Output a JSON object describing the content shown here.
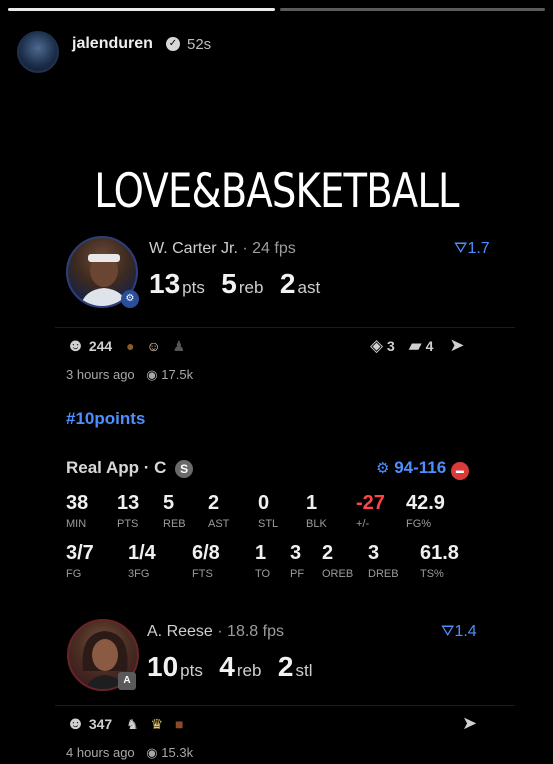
{
  "header": {
    "username": "jalenduren",
    "time": "52s"
  },
  "title": "LOVE&BASKETBALL",
  "post1": {
    "name": "W. Carter Jr.",
    "fps": "· 24 fps",
    "trend": "1.7",
    "stats": [
      {
        "value": "13",
        "unit": "pts"
      },
      {
        "value": "5",
        "unit": "reb"
      },
      {
        "value": "2",
        "unit": "ast"
      }
    ],
    "reactions_count": "244",
    "comments_count": "3",
    "cards_count": "4",
    "time_ago": "3 hours ago",
    "views": "17.5k"
  },
  "hashtag": "#10points",
  "boxscore": {
    "title": "Real App · C",
    "badge": "S",
    "score": "94-116",
    "row1": [
      {
        "value": "38",
        "label": "MIN"
      },
      {
        "value": "13",
        "label": "PTS"
      },
      {
        "value": "5",
        "label": "REB"
      },
      {
        "value": "2",
        "label": "AST"
      },
      {
        "value": "0",
        "label": "STL"
      },
      {
        "value": "1",
        "label": "BLK"
      },
      {
        "value": "-27",
        "label": "+/-"
      },
      {
        "value": "42.9",
        "label": "FG%"
      }
    ],
    "row2": [
      {
        "value": "3/7",
        "label": "FG"
      },
      {
        "value": "1/4",
        "label": "3FG"
      },
      {
        "value": "6/8",
        "label": "FTS"
      },
      {
        "value": "1",
        "label": "TO"
      },
      {
        "value": "3",
        "label": "PF"
      },
      {
        "value": "2",
        "label": "OREB"
      },
      {
        "value": "3",
        "label": "DREB"
      },
      {
        "value": "61.8",
        "label": "TS%"
      }
    ]
  },
  "post2": {
    "name": "A. Reese",
    "fps": "· 18.8 fps",
    "trend": "1.4",
    "badge": "A",
    "stats": [
      {
        "value": "10",
        "unit": "pts"
      },
      {
        "value": "4",
        "unit": "reb"
      },
      {
        "value": "2",
        "unit": "stl"
      }
    ],
    "reactions_count": "347",
    "time_ago": "4 hours ago",
    "views": "15.3k"
  },
  "colors": {
    "accent": "#4e8fff",
    "negative": "#ff4545",
    "background": "#000000"
  }
}
